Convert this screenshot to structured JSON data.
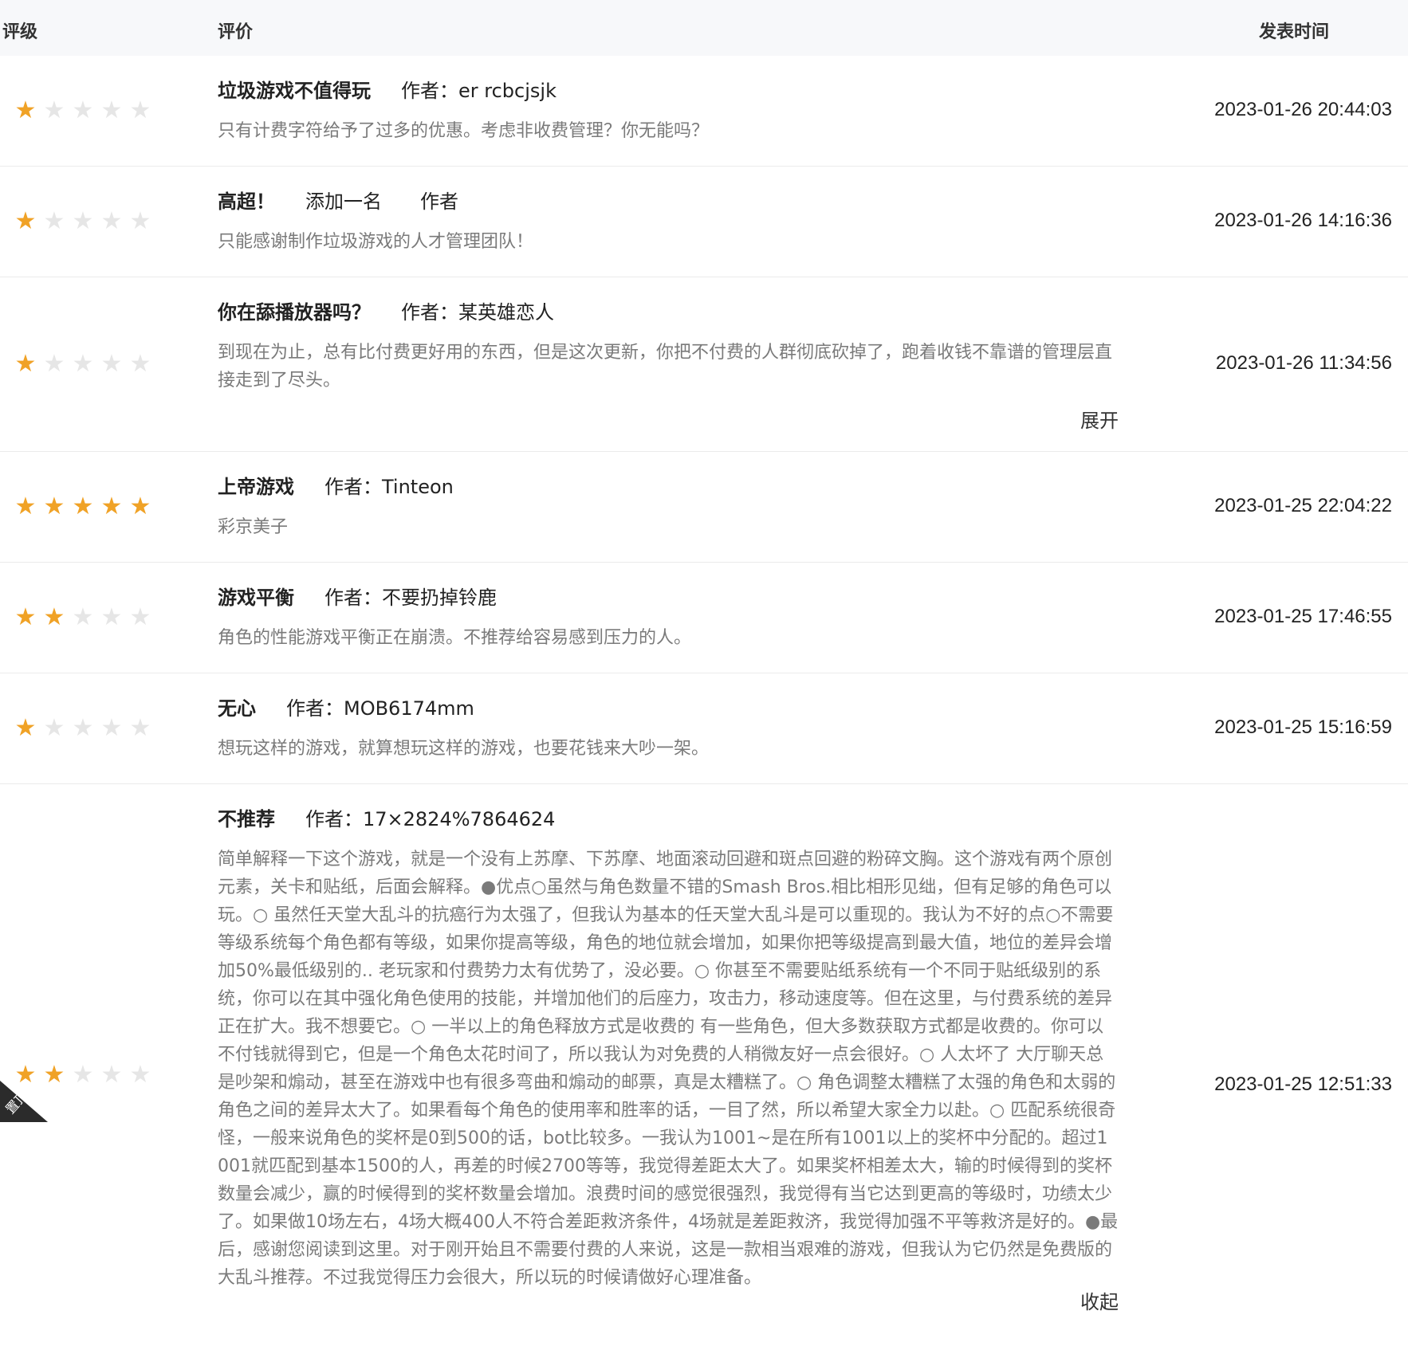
{
  "header": {
    "rating": "评级",
    "review": "评价",
    "time": "发表时间"
  },
  "colors": {
    "star_on": "#f0a226",
    "star_off": "#e6e6e6",
    "header_bg": "#f7f8fa"
  },
  "reviews": [
    {
      "title": "垃圾游戏不值得玩",
      "author": "作者：er rcbcjsjk",
      "body": "只有计费字符给予了过多的优惠。考虑非收费管理？你无能吗？",
      "rating": 1,
      "time": "2023-01-26 20:44:03"
    },
    {
      "title": "高超！",
      "author": "添加一名　　作者",
      "body": "只能感谢制作垃圾游戏的人才管理团队！",
      "rating": 1,
      "time": "2023-01-26 14:16:36"
    },
    {
      "title": "你在舔播放器吗？",
      "author": "作者：某英雄恋人",
      "body": "到现在为止，总有比付费更好用的东西，但是这次更新，你把不付费的人群彻底砍掉了，跑着收钱不靠谱的管理层直接走到了尽头。",
      "rating": 1,
      "time": "2023-01-26 11:34:56",
      "toggle": "展开"
    },
    {
      "title": "上帝游戏",
      "author": "作者：Tinteon",
      "body": "彩京美子",
      "rating": 5,
      "time": "2023-01-25 22:04:22"
    },
    {
      "title": "游戏平衡",
      "author": "作者：不要扔掉铃鹿",
      "body": "角色的性能游戏平衡正在崩溃。不推荐给容易感到压力的人。",
      "rating": 2,
      "time": "2023-01-25 17:46:55"
    },
    {
      "title": "无心",
      "author": "作者：MOB6174mm",
      "body": "想玩这样的游戏，就算想玩这样的游戏，也要花钱来大吵一架。",
      "rating": 1,
      "time": "2023-01-25 15:16:59"
    },
    {
      "title": "不推荐",
      "author": "作者：17×2824%7864624",
      "body": "简单解释一下这个游戏，就是一个没有上苏摩、下苏摩、地面滚动回避和斑点回避的粉碎文胸。这个游戏有两个原创元素，关卡和贴纸，后面会解释。●优点○虽然与角色数量不错的Smash Bros.相比相形见绌，但有足够的角色可以玩。○ 虽然任天堂大乱斗的抗癌行为太强了，但我认为基本的任天堂大乱斗是可以重现的。我认为不好的点○不需要等级系统每个角色都有等级，如果你提高等级，角色的地位就会增加，如果你把等级提高到最大值，地位的差异会增加50%最低级别的.. 老玩家和付费势力太有优势了，没必要。○ 你甚至不需要贴纸系统有一个不同于贴纸级别的系统，你可以在其中强化角色使用的技能，并增加他们的后座力，攻击力，移动速度等。但在这里，与付费系统的差异正在扩大。我不想要它。○ 一半以上的角色释放方式是收费的 有一些角色，但大多数获取方式都是收费的。你可以不付钱就得到它，但是一个角色太花时间了，所以我认为对免费的人稍微友好一点会很好。○ 人太坏了 大厅聊天总是吵架和煽动，甚至在游戏中也有很多弯曲和煽动的邮票，真是太糟糕了。○ 角色调整太糟糕了太强的角色和太弱的角色之间的差异太大了。如果看每个角色的使用率和胜率的话，一目了然，所以希望大家全力以赴。○ 匹配系统很奇怪，一般来说角色的奖杯是0到500的话，bot比较多。一我认为1001~是在所有1001以上的奖杯中分配的。超过1001就匹配到基本1500的人，再差的时候2700等等，我觉得差距太大了。如果奖杯相差太大，输的时候得到的奖杯数量会减少，赢的时候得到的奖杯数量会增加。浪费时间的感觉很强烈，我觉得有当它达到更高的等级时，功绩太少了。如果做10场左右，4场大概400人不符合差距救济条件，4场就是差距救济，我觉得加强不平等救济是好的。●最后，感谢您阅读到这里。对于刚开始且不需要付费的人来说，这是一款相当艰难的游戏，但我认为它仍然是免费版的大乱斗推荐。不过我觉得压力会很大，所以玩的时候请做好心理准备。",
      "rating": 2,
      "time": "2023-01-25 12:51:33",
      "toggle": "收起",
      "pinned_label": "置顶"
    }
  ]
}
